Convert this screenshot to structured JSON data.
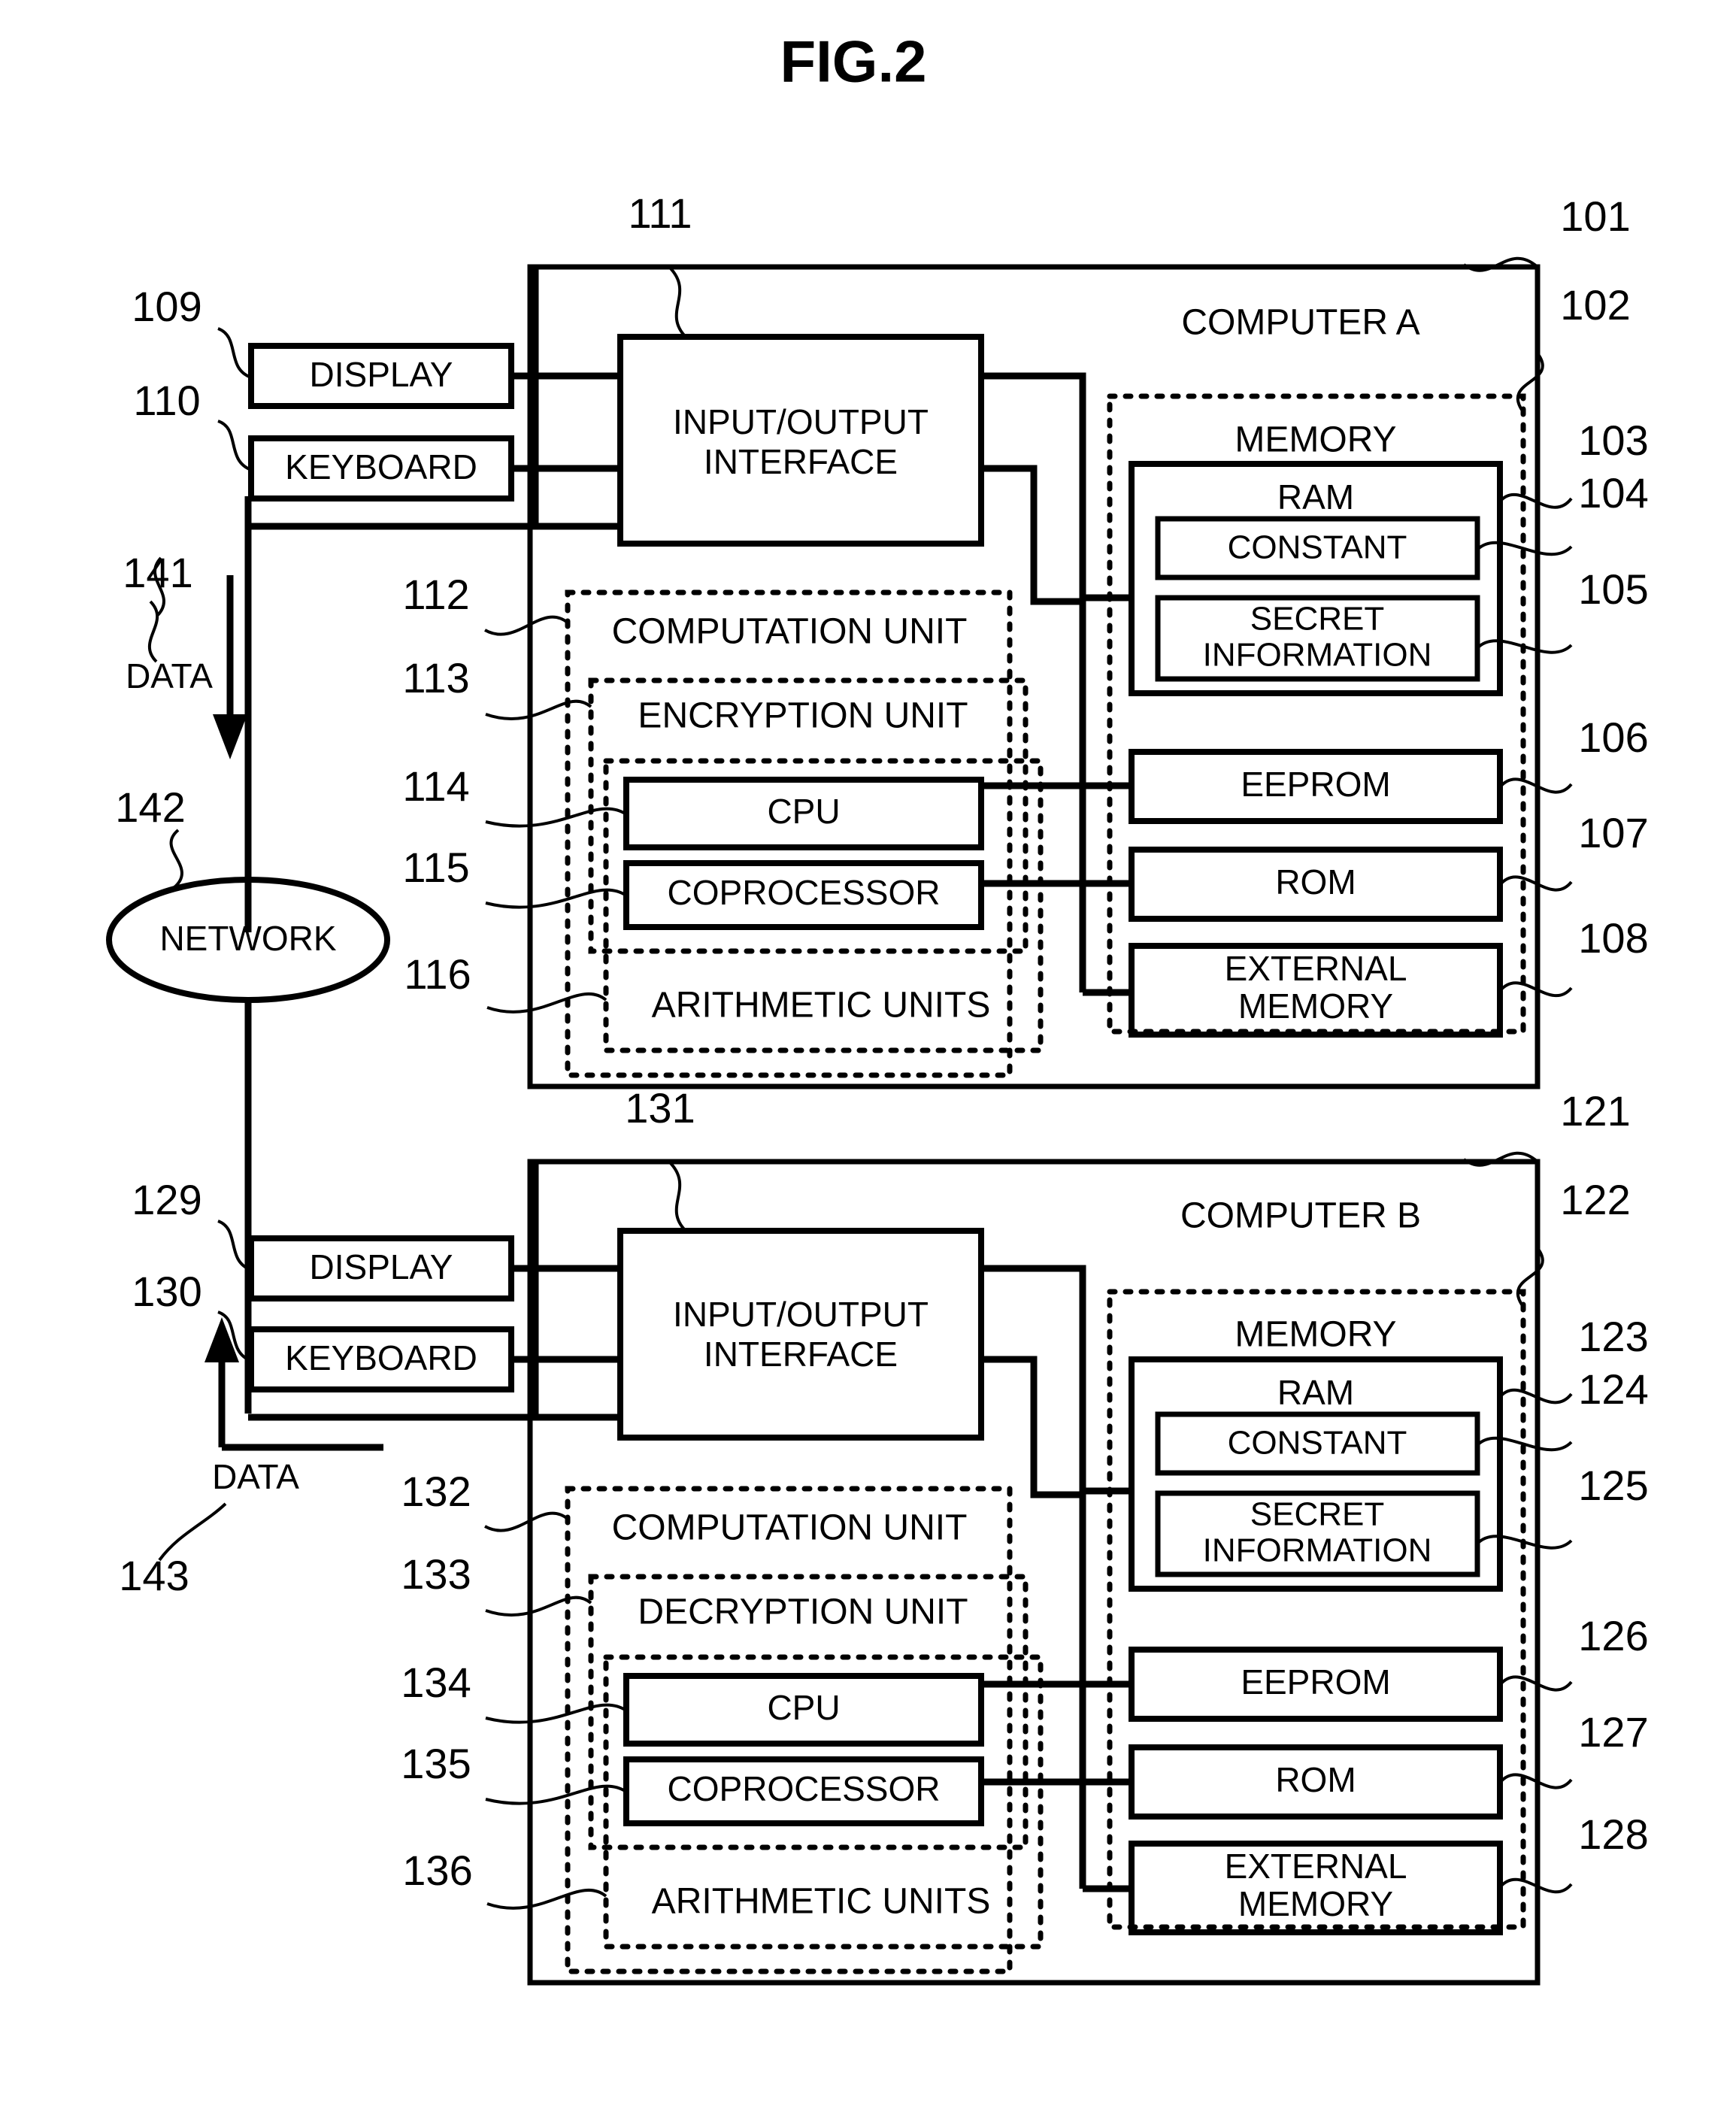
{
  "figure": {
    "title": "FIG.2",
    "type": "patent-block-diagram"
  },
  "computer_a": {
    "ref": "101",
    "name": "COMPUTER A",
    "peripherals": [
      {
        "ref": "109",
        "label": "DISPLAY"
      },
      {
        "ref": "110",
        "label": "KEYBOARD"
      }
    ],
    "io_interface": {
      "ref": "111",
      "label": "INPUT/OUTPUT INTERFACE",
      "line1": "INPUT/OUTPUT",
      "line2": "INTERFACE"
    },
    "memory": {
      "ref": "102",
      "label": "MEMORY",
      "ram": {
        "ref": "103",
        "label": "RAM",
        "items": [
          {
            "ref": "104",
            "label": "CONSTANT"
          },
          {
            "ref": "105",
            "label": "SECRET INFORMATION",
            "line1": "SECRET",
            "line2": "INFORMATION"
          }
        ]
      },
      "others": [
        {
          "ref": "106",
          "label": "EEPROM"
        },
        {
          "ref": "107",
          "label": "ROM"
        },
        {
          "ref": "108",
          "label": "EXTERNAL MEMORY",
          "line1": "EXTERNAL",
          "line2": "MEMORY"
        }
      ]
    },
    "computation_unit": {
      "ref": "112",
      "label": "COMPUTATION UNIT",
      "crypto_unit": {
        "ref": "113",
        "label": "ENCRYPTION UNIT"
      },
      "arithmetic_units": {
        "ref": "116",
        "label": "ARITHMETIC UNITS"
      },
      "processors": [
        {
          "ref": "114",
          "label": "CPU"
        },
        {
          "ref": "115",
          "label": "COPROCESSOR"
        }
      ]
    }
  },
  "computer_b": {
    "ref": "121",
    "name": "COMPUTER B",
    "peripherals": [
      {
        "ref": "129",
        "label": "DISPLAY"
      },
      {
        "ref": "130",
        "label": "KEYBOARD"
      }
    ],
    "io_interface": {
      "ref": "131",
      "label": "INPUT/OUTPUT INTERFACE",
      "line1": "INPUT/OUTPUT",
      "line2": "INTERFACE"
    },
    "memory": {
      "ref": "122",
      "label": "MEMORY",
      "ram": {
        "ref": "123",
        "label": "RAM",
        "items": [
          {
            "ref": "124",
            "label": "CONSTANT"
          },
          {
            "ref": "125",
            "label": "SECRET INFORMATION",
            "line1": "SECRET",
            "line2": "INFORMATION"
          }
        ]
      },
      "others": [
        {
          "ref": "126",
          "label": "EEPROM"
        },
        {
          "ref": "127",
          "label": "ROM"
        },
        {
          "ref": "128",
          "label": "EXTERNAL MEMORY",
          "line1": "EXTERNAL",
          "line2": "MEMORY"
        }
      ]
    },
    "computation_unit": {
      "ref": "132",
      "label": "COMPUTATION UNIT",
      "crypto_unit": {
        "ref": "133",
        "label": "DECRYPTION UNIT"
      },
      "arithmetic_units": {
        "ref": "136",
        "label": "ARITHMETIC UNITS"
      },
      "processors": [
        {
          "ref": "134",
          "label": "CPU"
        },
        {
          "ref": "135",
          "label": "COPROCESSOR"
        }
      ]
    }
  },
  "network": {
    "ref": "142",
    "label": "NETWORK"
  },
  "data_flows": [
    {
      "ref": "141",
      "label": "DATA",
      "direction": "down"
    },
    {
      "ref": "143",
      "label": "DATA",
      "direction": "up"
    }
  ]
}
